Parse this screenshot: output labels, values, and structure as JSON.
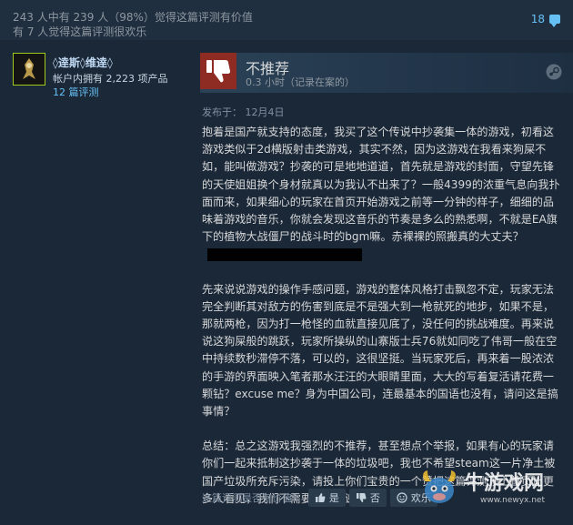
{
  "helpful": {
    "line1": "243 人中有 239 人（98%）觉得这篇评测有价值",
    "line2": "有 7 人觉得这篇评测很欢乐",
    "comment_count": "18"
  },
  "author": {
    "name": "◊逹斯◊维逹◊",
    "products_owned": "帐户内拥有 2,223 项产品",
    "reviews": "12 篇评测"
  },
  "review": {
    "verdict": "不推荐",
    "hours": "0.3 小时（记录在案的）",
    "posted": "发布于：  12月4日",
    "paragraphs": [
      "抱着是国产就支持的态度，我买了这个传说中抄袭集一体的游戏，初看这游戏类似于2d横版射击类游戏，其实不然，因为这游戏在我看来狗屎不如，能叫做游戏？抄袭的可是地地道道，首先就是游戏的封面，守望先锋的天使姐姐换个身材就真以为我认不出来了？一般4399的浓重气息向我扑面而来，如果细心的玩家在首页开始游戏之前等一分钟的样子，细细的品味着游戏的音乐，你就会发现这音乐的节奏是多么的熟悉啊，不就是EA旗下的植物大战僵尸的战斗时的bgm嘛。赤裸裸的照搬真的大丈夫？",
      "先来说说游戏的操作手感问题，游戏的整体风格打击飘忽不定，玩家无法完全判断其对敌方的伤害到底是不是强大到一枪就死的地步，如果不是，那就两枪，因为打一枪怪的血就直接见底了，没任何的挑战难度。再来说说这狗屎般的跳跃，玩家所操纵的山寨版士兵76就如同吃了伟哥一般在空中持续数秒滞停不落，可以的，这很坚挺。当玩家死后，再来着一股浓浓的手游的界面映入笔者那水汪汪的大眼睛里面，大大的写着复活请花费一颗钻？excuse me？身为中国公司，连最基本的国语也没有，请问这是搞事情？",
      "总结：总之这游戏我强烈的不推荐，甚至想点个举报，如果有心的玩家请你们一起来抵制这抄袭于一体的垃圾吧，我也不希望steam这一片净土被国产垃圾所充斥污染，请投上你们宝贵的一个赞把这篇评测顶上首页让更多人看见，我们不需要垃圾，谢谢！！！"
    ]
  },
  "footer": {
    "question": "这篇评测是否有价值?",
    "yes": "是",
    "no": "否",
    "funny": "欢乐"
  },
  "watermark": {
    "title": "牛游戏网",
    "url": "www.newyx.net"
  },
  "colors": {
    "background": "#1b2838",
    "link": "#66c0f4",
    "thumb_down": "#8e2b22"
  }
}
